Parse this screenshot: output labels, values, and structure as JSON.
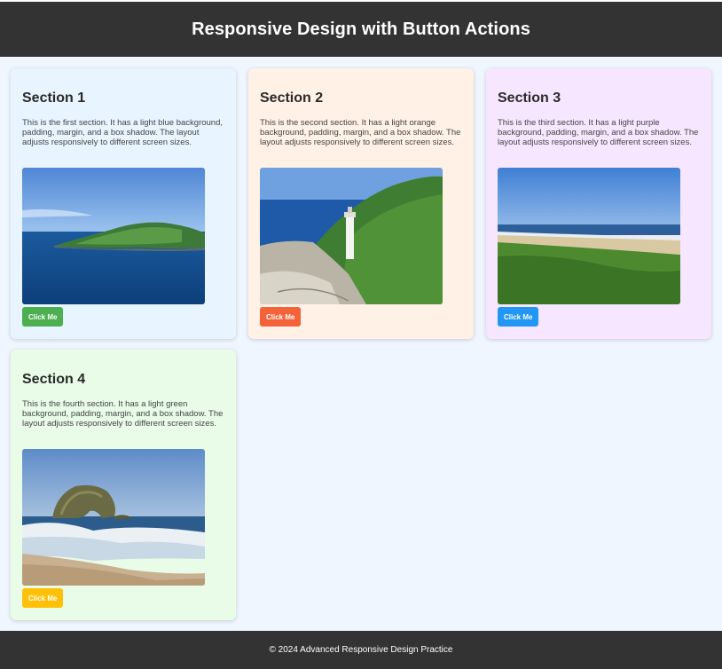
{
  "header": {
    "title": "Responsive Design with Button Actions"
  },
  "sections": [
    {
      "title": "Section 1",
      "text": "This is the first section. It has a light blue background, padding, margin, and a box shadow. The layout adjusts responsively to different screen sizes.",
      "image": "island-ocean-photo",
      "button_label": "Click Me",
      "background": "#e8f4ff",
      "button_color": "#4caf50"
    },
    {
      "title": "Section 2",
      "text": "This is the second section. It has a light orange background, padding, margin, and a box shadow. The layout adjusts responsively to different screen sizes.",
      "image": "lighthouse-coast-photo",
      "button_label": "Click Me",
      "background": "#fff1e6",
      "button_color": "#f4623a"
    },
    {
      "title": "Section 3",
      "text": "This is the third section. It has a light purple background, padding, margin, and a box shadow. The layout adjusts responsively to different screen sizes.",
      "image": "beach-grass-photo",
      "button_label": "Click Me",
      "background": "#f7e6ff",
      "button_color": "#2196f3"
    },
    {
      "title": "Section 4",
      "text": "This is the fourth section. It has a light green background, padding, margin, and a box shadow. The layout adjusts responsively to different screen sizes.",
      "image": "sea-rock-waves-photo",
      "button_label": "Click Me",
      "background": "#e8fce8",
      "button_color": "#ffc107"
    }
  ],
  "footer": {
    "text": "© 2024 Advanced Responsive Design Practice"
  },
  "colors": {
    "header_bg": "#333333",
    "page_bg": "#f0f6ff",
    "footer_bg": "#333333"
  }
}
